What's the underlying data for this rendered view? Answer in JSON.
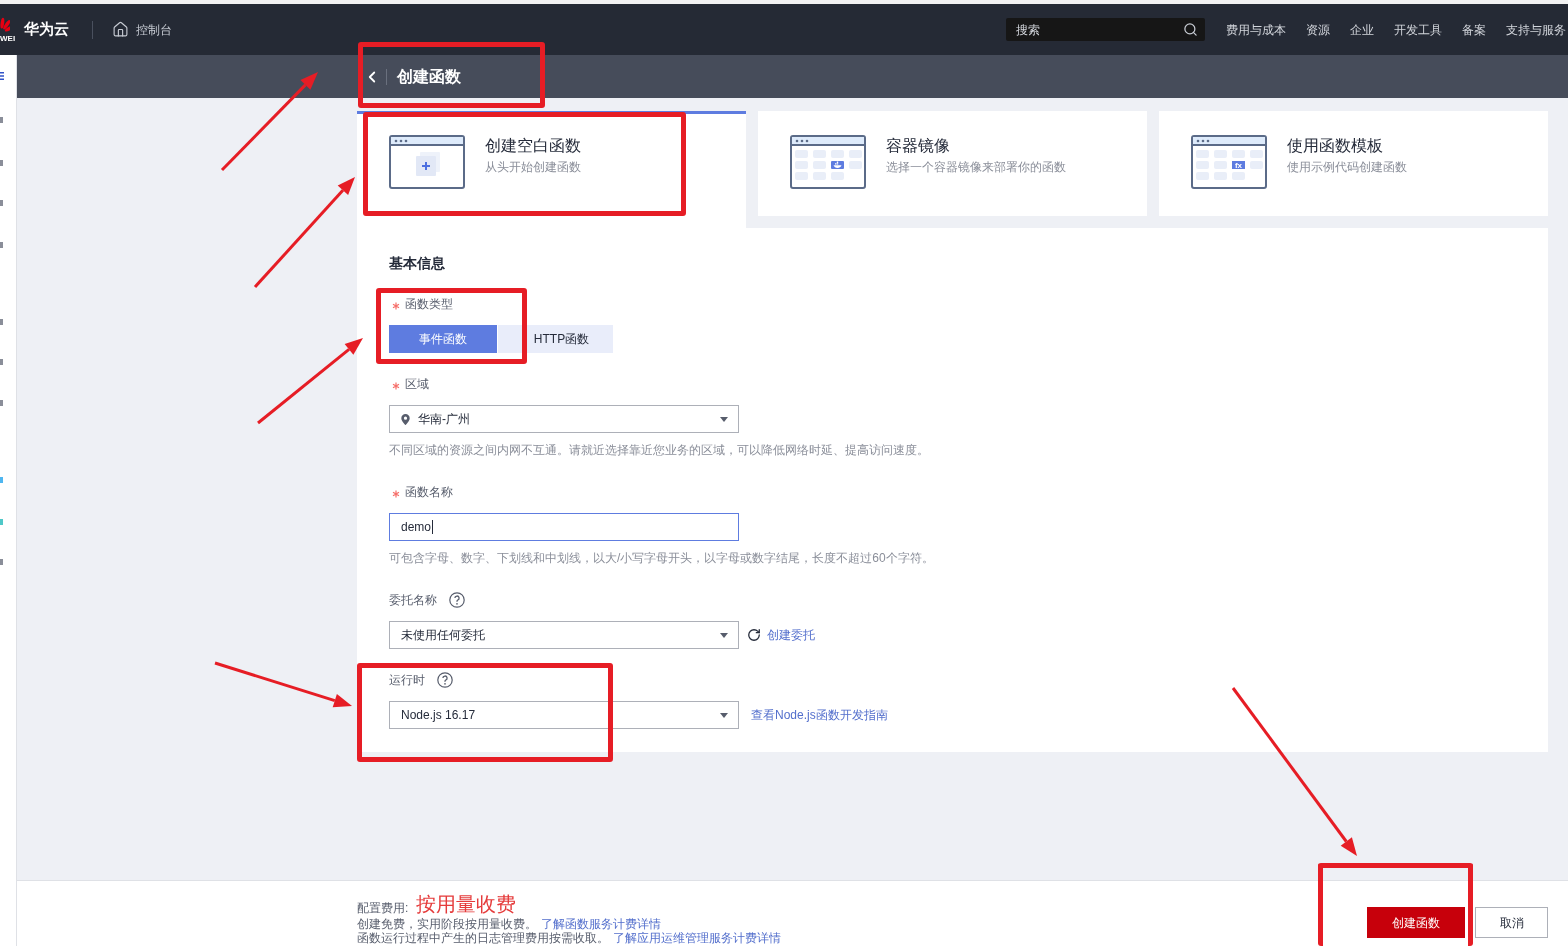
{
  "header": {
    "logo_text": "WEI",
    "brand": "华为云",
    "console_link": "控制台",
    "search": {
      "placeholder": "搜索"
    },
    "nav": [
      "费用与成本",
      "资源",
      "企业",
      "开发工具",
      "备案",
      "支持与服务"
    ]
  },
  "page_header": {
    "title": "创建函数"
  },
  "creation_methods": [
    {
      "kind": "blank",
      "title": "创建空白函数",
      "subtitle": "从头开始创建函数",
      "selected": true
    },
    {
      "kind": "container",
      "title": "容器镜像",
      "subtitle": "选择一个容器镜像来部署你的函数",
      "selected": false
    },
    {
      "kind": "template",
      "title": "使用函数模板",
      "subtitle": "使用示例代码创建函数",
      "selected": false,
      "icon_text": "fx"
    }
  ],
  "form": {
    "section_title": "基本信息",
    "fields": [
      {
        "kind": "segmented",
        "label": "函数类型",
        "required": true,
        "options": [
          {
            "label": "事件函数",
            "selected": true
          },
          {
            "label": "HTTP函数",
            "selected": false
          }
        ]
      },
      {
        "kind": "location",
        "label": "区域",
        "required": true,
        "value": "华南-广州",
        "hint": "不同区域的资源之间内网不互通。请就近选择靠近您业务的区域，可以降低网络时延、提高访问速度。"
      },
      {
        "kind": "input",
        "label": "函数名称",
        "required": true,
        "value": "demo",
        "focused": true,
        "hint": "可包含字母、数字、下划线和中划线，以大/小写字母开头，以字母或数字结尾，长度不超过60个字符。"
      },
      {
        "kind": "select",
        "label": "委托名称",
        "required": false,
        "help": true,
        "value": "未使用任何委托",
        "action": {
          "kind": "refresh",
          "label": "创建委托"
        }
      },
      {
        "kind": "select",
        "label": "运行时",
        "required": false,
        "help": true,
        "value": "Node.js 16.17",
        "action": {
          "kind": "link",
          "label": "查看Node.js函数开发指南"
        }
      }
    ]
  },
  "footer": {
    "fee_label": "配置费用:",
    "fee_value": "按用量收费",
    "lines": [
      {
        "text": "创建免费，实用阶段按用量收费。",
        "link": "了解函数服务计费详情"
      },
      {
        "text": "函数运行过程中产生的日志管理费用按需收取。",
        "link": "了解应用运维管理服务计费详情"
      }
    ],
    "buttons": [
      {
        "kind": "primary",
        "label": "创建函数"
      },
      {
        "kind": "secondary",
        "label": "取消"
      }
    ]
  }
}
